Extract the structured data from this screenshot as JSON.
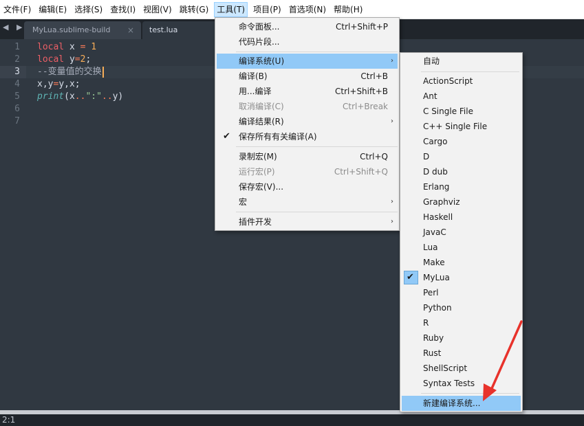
{
  "menubar": {
    "items": [
      "文件(F)",
      "编辑(E)",
      "选择(S)",
      "查找(I)",
      "视图(V)",
      "跳转(G)",
      "工具(T)",
      "项目(P)",
      "首选项(N)",
      "帮助(H)"
    ]
  },
  "tabs": [
    {
      "label": "MyLua.sublime-build",
      "close": "×"
    },
    {
      "label": "test.lua"
    }
  ],
  "tab_nav": "◀ ▶",
  "editor": {
    "line_numbers": [
      "1",
      "2",
      "3",
      "4",
      "5",
      "6",
      "7"
    ],
    "lines": {
      "l1": {
        "kw": "local",
        "rest": " x ",
        "op": "=",
        "num": " 1"
      },
      "l2": {
        "kw": "local",
        "rest": " y",
        "op": "=",
        "num": "2",
        "tail": ";"
      },
      "l3": {
        "cmt": "--变量值的交换"
      },
      "l4": {
        "a": "x,y",
        "op": "=",
        "b": "y,x;"
      },
      "l5": {
        "fn": "print",
        "a": "(x",
        "op1": "..",
        "str": "\":\"",
        "op2": "..",
        "b": "y)"
      }
    }
  },
  "status": {
    "position": "2:1"
  },
  "tools_menu": {
    "items": [
      {
        "label": "命令面板...",
        "shortcut": "Ctrl+Shift+P"
      },
      {
        "label": "代码片段..."
      },
      {
        "label": "编译系统(U)",
        "submenu": "›"
      },
      {
        "label": "编译(B)",
        "shortcut": "Ctrl+B"
      },
      {
        "label": "用...编译",
        "shortcut": "Ctrl+Shift+B"
      },
      {
        "label": "取消编译(C)",
        "shortcut": "Ctrl+Break"
      },
      {
        "label": "编译结果(R)",
        "submenu": "›"
      },
      {
        "label": "保存所有有关编译(A)",
        "check": "✔"
      },
      {
        "label": "录制宏(M)",
        "shortcut": "Ctrl+Q"
      },
      {
        "label": "运行宏(P)",
        "shortcut": "Ctrl+Shift+Q"
      },
      {
        "label": "保存宏(V)..."
      },
      {
        "label": "宏",
        "submenu": "›"
      },
      {
        "label": "插件开发",
        "submenu": "›"
      }
    ]
  },
  "build_menu": {
    "auto": "自动",
    "systems": [
      "ActionScript",
      "Ant",
      "C Single File",
      "C++ Single File",
      "Cargo",
      "D",
      "D dub",
      "Erlang",
      "Graphviz",
      "Haskell",
      "JavaC",
      "Lua",
      "Make",
      "MyLua",
      "Perl",
      "Python",
      "R",
      "Ruby",
      "Rust",
      "ShellScript",
      "Syntax Tests"
    ],
    "selected_check": "✔",
    "new_system": "新建编译系统..."
  },
  "colors": {
    "editor_bg": "#303841",
    "highlight": "#91c9f7",
    "arrow": "#e8322b"
  }
}
